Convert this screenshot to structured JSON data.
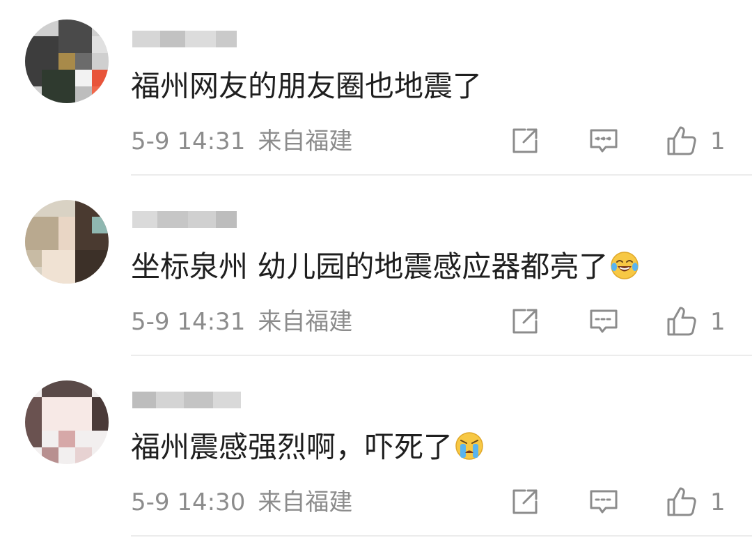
{
  "comments": [
    {
      "text": "福州网友的朋友圈也地震了",
      "time": "5-9 14:31",
      "location": "来自福建",
      "likes": "1",
      "emoji": ""
    },
    {
      "text": "坐标泉州 幼儿园的地震感应器都亮了",
      "time": "5-9 14:31",
      "location": "来自福建",
      "likes": "1",
      "emoji": "laughing-tears"
    },
    {
      "text": "福州震感强烈啊，吓死了",
      "time": "5-9 14:30",
      "location": "来自福建",
      "likes": "1",
      "emoji": "crying"
    }
  ],
  "icons": {
    "repost": "repost-icon",
    "reply": "reply-icon",
    "like": "thumbs-up-icon"
  },
  "colors": {
    "text": "#1f1f1f",
    "meta": "#8c8c8c",
    "icon": "#8c8c8c",
    "divider": "#ececec"
  }
}
